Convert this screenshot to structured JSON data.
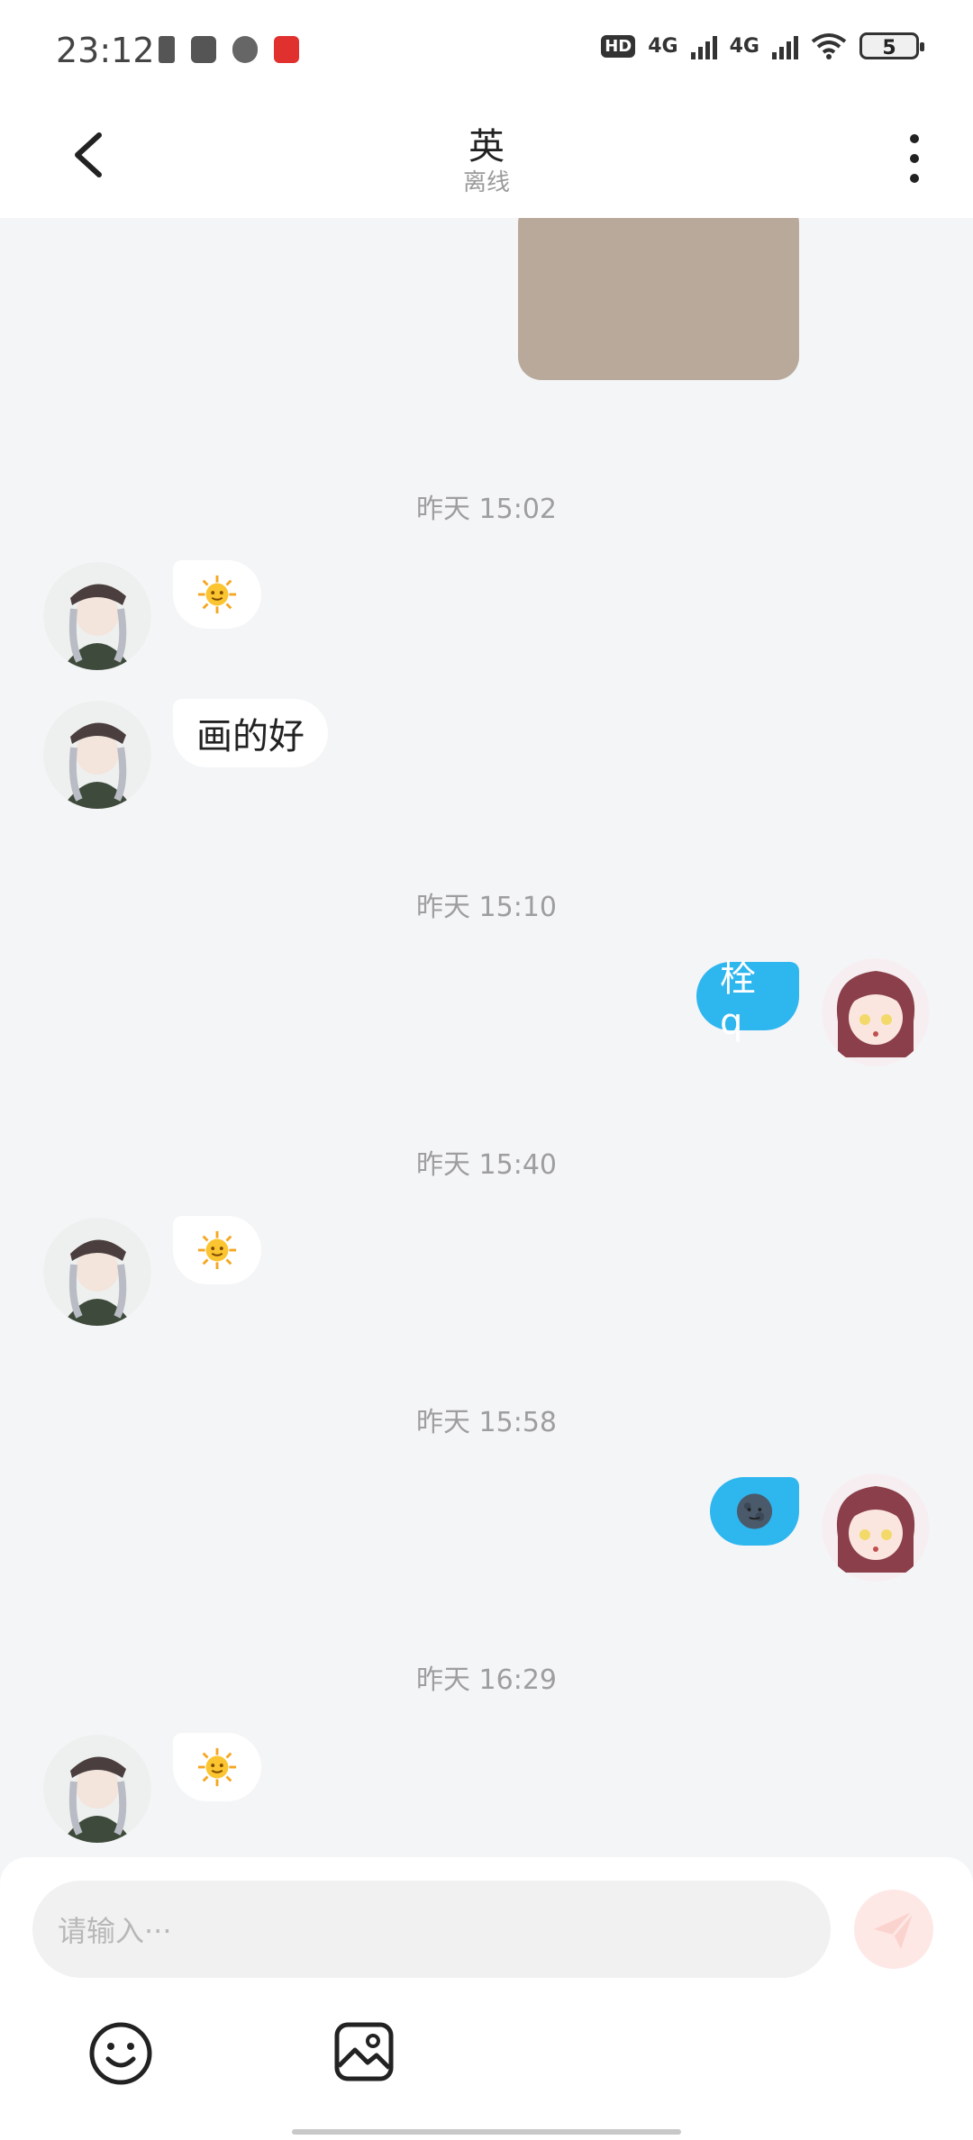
{
  "status_bar": {
    "time": "23:12",
    "network_1": "4G",
    "network_2": "4G",
    "hd_label": "HD",
    "battery": "5"
  },
  "header": {
    "title": "英",
    "subtitle": "离线"
  },
  "messages": {
    "t1": "昨天 15:02",
    "m_text_1": "画的好",
    "t2": "昨天 15:10",
    "m_text_out_1": "栓q",
    "t3": "昨天 15:40",
    "t4": "昨天 15:58",
    "t5": "昨天 16:29"
  },
  "input": {
    "placeholder": "请输入···"
  },
  "colors": {
    "outgoing_bubble": "#2eb6ef",
    "incoming_bubble": "#ffffff",
    "background": "#f4f5f7"
  },
  "icons": [
    "back-arrow-icon",
    "more-vertical-icon",
    "sun-emoji",
    "moon-emoji",
    "send-icon",
    "smile-icon",
    "image-icon"
  ]
}
